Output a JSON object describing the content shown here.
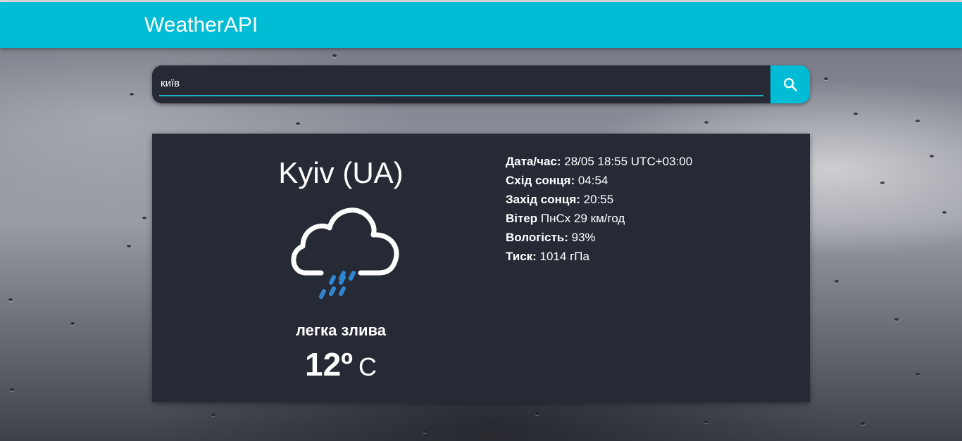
{
  "navbar": {
    "brand": "WeatherAPI"
  },
  "search": {
    "value": "київ",
    "button_icon": "search-icon"
  },
  "colors": {
    "accent": "#00bcd4",
    "card": "#262a35",
    "rain": "#2f86d3"
  },
  "weather": {
    "city": "Kyiv (UA)",
    "icon": "cloud-rain-icon",
    "description": "легка злива",
    "temp_value": "12º",
    "temp_unit": "C"
  },
  "details": [
    {
      "label": "Дата/час:",
      "value": "28/05 18:55 UTC+03:00"
    },
    {
      "label": "Схід сонця:",
      "value": "04:54"
    },
    {
      "label": "Захід сонця:",
      "value": "20:55"
    },
    {
      "label": "Вітер",
      "value": "ПнСх 29 км/год"
    },
    {
      "label": "Вологість:",
      "value": "93%"
    },
    {
      "label": "Тиск:",
      "value": "1014 гПа"
    }
  ]
}
